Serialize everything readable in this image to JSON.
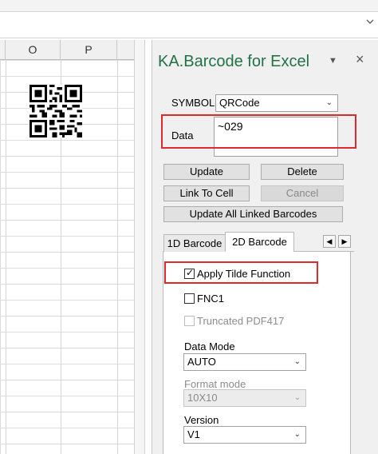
{
  "spreadsheet": {
    "columns": [
      "O",
      "P"
    ]
  },
  "pane": {
    "title": "KA.Barcode for Excel",
    "menu_glyph": "▼",
    "close_glyph": "×",
    "symbol_label": "SYMBOL",
    "symbol_value": "QRCode",
    "data_label": "Data",
    "data_value": "~029",
    "buttons": {
      "update": "Update",
      "delete": "Delete",
      "link_to_cell": "Link To Cell",
      "cancel": "Cancel",
      "update_all": "Update All Linked Barcodes"
    },
    "tabs": {
      "tab_1d": "1D Barcode",
      "tab_2d": "2D Barcode",
      "prev_glyph": "◀",
      "next_glyph": "▶"
    },
    "options": {
      "apply_tilde": "Apply Tilde Function",
      "apply_tilde_checked": true,
      "fnc1": "FNC1",
      "fnc1_checked": false,
      "truncated_pdf417": "Truncated PDF417",
      "truncated_checked": false,
      "data_mode_label": "Data Mode",
      "data_mode_value": "AUTO",
      "format_mode_label": "Format mode",
      "format_mode_value": "10X10",
      "version_label": "Version",
      "version_value": "V1"
    },
    "check_glyph": "✓",
    "dropdown_glyph": "⌄",
    "colors": {
      "title": "#217346",
      "highlight": "#e0292e"
    }
  }
}
